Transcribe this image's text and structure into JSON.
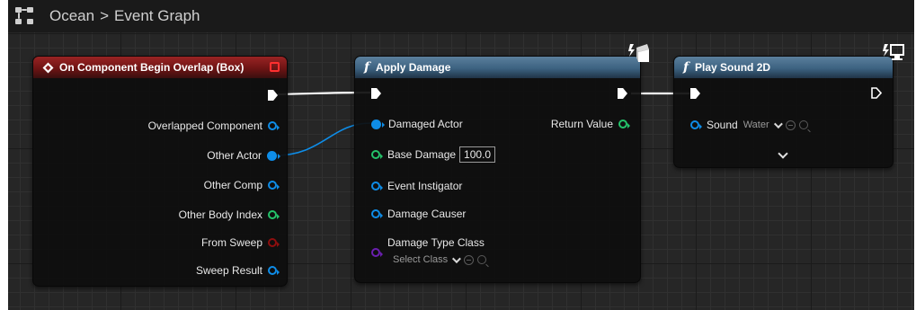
{
  "breadcrumb": {
    "blueprint": "Ocean",
    "separator": ">",
    "graph": "Event Graph"
  },
  "event_node": {
    "title": "On Component Begin Overlap (Box)",
    "pins": [
      {
        "label": "Overlapped Component",
        "type": "object"
      },
      {
        "label": "Other Actor",
        "type": "object",
        "connected": true
      },
      {
        "label": "Other Comp",
        "type": "object"
      },
      {
        "label": "Other Body Index",
        "type": "integer"
      },
      {
        "label": "From Sweep",
        "type": "boolean"
      },
      {
        "label": "Sweep Result",
        "type": "struct"
      }
    ]
  },
  "apply_damage_node": {
    "title": "Apply Damage",
    "function_glyph": "f",
    "inputs": [
      {
        "label": "Damaged Actor",
        "type": "object",
        "connected": true
      },
      {
        "label": "Base Damage",
        "type": "float",
        "value": "100.0"
      },
      {
        "label": "Event Instigator",
        "type": "object"
      },
      {
        "label": "Damage Causer",
        "type": "object"
      },
      {
        "label": "Damage Type Class",
        "type": "class",
        "value": "Select Class"
      }
    ],
    "outputs": [
      {
        "label": "Return Value",
        "type": "float"
      }
    ]
  },
  "play_sound_node": {
    "title": "Play Sound 2D",
    "function_glyph": "f",
    "inputs": [
      {
        "label": "Sound",
        "type": "object",
        "value": "Water"
      }
    ]
  },
  "colors": {
    "event_header": "#8a1d1d",
    "function_header": "#3c6281",
    "object_pin": "#0e8de8",
    "integer_pin": "#24c36a",
    "boolean_pin": "#8e0e0e",
    "class_pin": "#6b1fb0",
    "exec_wire": "#ffffff"
  }
}
